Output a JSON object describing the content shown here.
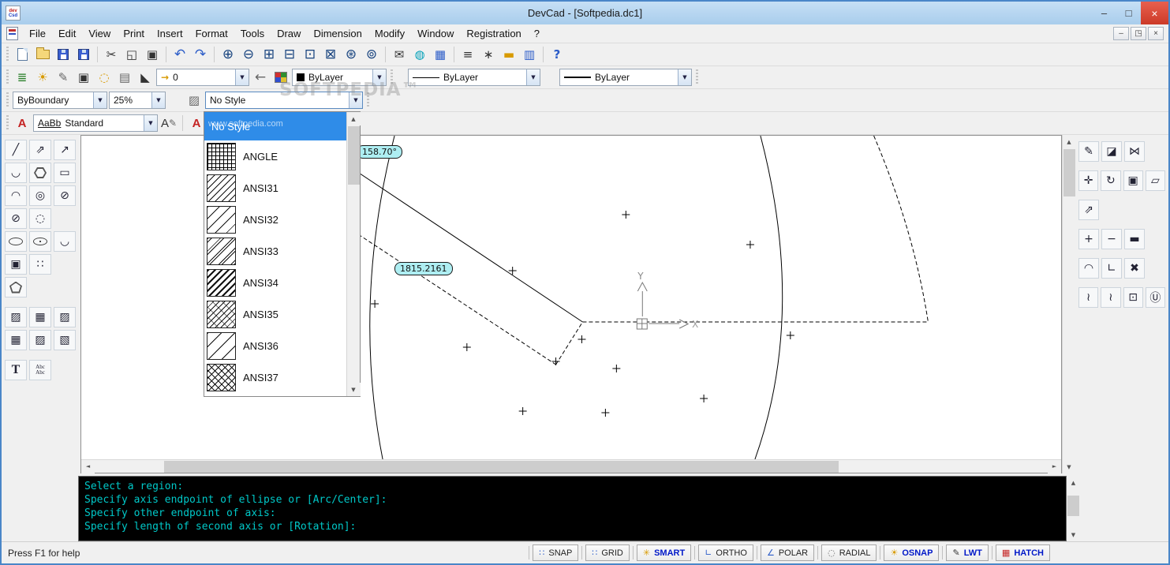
{
  "window": {
    "title": "DevCad - [Softpedia.dc1]",
    "icon_top": "dev",
    "icon_bottom": "Csd",
    "minimize": "–",
    "maximize": "□",
    "close": "×"
  },
  "menu": {
    "items": [
      "File",
      "Edit",
      "View",
      "Print",
      "Insert",
      "Format",
      "Tools",
      "Draw",
      "Dimension",
      "Modify",
      "Window",
      "Registration",
      "?"
    ],
    "mdi_minimize": "–",
    "mdi_restore": "◳",
    "mdi_close": "×"
  },
  "tb1": {
    "cut": "✂",
    "copy": "◱",
    "paste": "▣",
    "undo": "↶",
    "redo": "↷",
    "zoom_in": "⊕",
    "zoom_out": "⊖",
    "zoom_window": "⊞",
    "zoom_previous": "⊟",
    "zoom_scale": "⊡",
    "zoom_center": "⊠",
    "zoom_extents": "⊛",
    "zoom_all": "⊚",
    "publish": "✉",
    "web": "◍",
    "display": "▦",
    "draw_order": "≡",
    "point_style": "∗",
    "ruler": "▬",
    "layout": "▥",
    "help": "?"
  },
  "tb2": {
    "layer_manager": "≣",
    "layer_on": "☀",
    "layer_edit": "✎",
    "layer_box": "▣",
    "layer_circle": "◌",
    "print_style": "▤",
    "flag": "◣",
    "layer_arrow": "→",
    "layer_value": "0",
    "layer_back": "←",
    "color_value": "ByLayer",
    "linetype_value": "ByLayer",
    "lineweight_value": "ByLayer"
  },
  "tb3": {
    "boundary_value": "ByBoundary",
    "scale_value": "25%",
    "hatch_icon": "▨",
    "style_value": "No Style"
  },
  "tb4": {
    "style_icon": "A",
    "preview": "AaBb",
    "style_name": "Standard",
    "edit_icon": "A",
    "pen_icon": "✎",
    "brush_icon": "A"
  },
  "left_palette": {
    "g0": "╱",
    "g1": "⇗",
    "g2": "↗",
    "g3": "◡",
    "g5": "▭",
    "g6": "◠",
    "g7": "◎",
    "g8": "⊘",
    "g9": "⊘",
    "g10": "◌",
    "g13": "◡",
    "g14": "▣",
    "g15": "∷",
    "g17": "▨",
    "g18": "▦",
    "g19": "▨",
    "g20": "▦",
    "g21": "▨",
    "g22": "▧",
    "g23": "T",
    "g24": "Abc Abc"
  },
  "right_palette": {
    "g0": "✎",
    "g1": "◪",
    "g2": "⋈",
    "g3": "✛",
    "g4": "↻",
    "g5": "▣",
    "g6": "▱",
    "g7": "⇗",
    "g8": "+",
    "g9": "−",
    "g10": "▬",
    "g11": "◠",
    "g12": "∟",
    "g13": "✖",
    "g14": "≀",
    "g15": "≀",
    "g16": "⊡",
    "g17": "Ⓤ"
  },
  "style_list": {
    "items": [
      {
        "label": "No Style",
        "selected": true
      },
      {
        "label": "ANGLE"
      },
      {
        "label": "ANSI31"
      },
      {
        "label": "ANSI32"
      },
      {
        "label": "ANSI33"
      },
      {
        "label": "ANSI34"
      },
      {
        "label": "ANSI35"
      },
      {
        "label": "ANSI36"
      },
      {
        "label": "ANSI37"
      }
    ]
  },
  "canvas": {
    "dim_length": "1815.2161",
    "dim_angle": "158.70°",
    "axis_x": "X",
    "axis_y": "Y"
  },
  "command": {
    "lines": [
      "Select a region:",
      "Specify axis endpoint of ellipse or [Arc/Center]:",
      "Specify other endpoint of axis:",
      "Specify length of second axis or [Rotation]:"
    ]
  },
  "status": {
    "help_text": "Press F1 for help",
    "toggles": [
      {
        "label": "SNAP",
        "glyph": "∷",
        "on": false
      },
      {
        "label": "GRID",
        "glyph": "∷",
        "on": false
      },
      {
        "label": "SMART",
        "glyph": "✳",
        "on": true
      },
      {
        "label": "ORTHO",
        "glyph": "∟",
        "on": false
      },
      {
        "label": "POLAR",
        "glyph": "∠",
        "on": false
      },
      {
        "label": "RADIAL",
        "glyph": "◌",
        "on": false
      },
      {
        "label": "OSNAP",
        "glyph": "☀",
        "on": true
      },
      {
        "label": "LWT",
        "glyph": "✎",
        "on": true
      },
      {
        "label": "HATCH",
        "glyph": "▦",
        "on": true
      }
    ]
  },
  "ui": {
    "dropdown_arrow": "▼",
    "scroll_up": "▲",
    "scroll_down": "▼",
    "scroll_left": "◄",
    "scroll_right": "►"
  },
  "watermark": {
    "big": "SOFTPEDIA™",
    "small": "www.softpedia.com"
  },
  "colors": {
    "titlebar": "#b9d8f2",
    "close_button": "#da4332",
    "selection": "#2f8ce8",
    "command_text": "#00c8c8"
  }
}
